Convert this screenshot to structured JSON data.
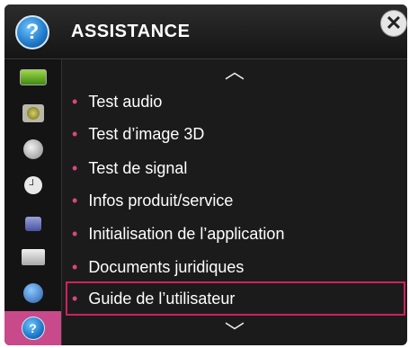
{
  "header": {
    "title": "ASSISTANCE"
  },
  "sidebar": {
    "items": [
      {
        "icon": "tv-icon"
      },
      {
        "icon": "speaker-icon"
      },
      {
        "icon": "satellite-dish-icon"
      },
      {
        "icon": "clock-icon"
      },
      {
        "icon": "lock-icon"
      },
      {
        "icon": "toolbox-icon"
      },
      {
        "icon": "globe-icon"
      },
      {
        "icon": "help-icon"
      }
    ]
  },
  "menu": {
    "items": [
      {
        "label": "Test audio"
      },
      {
        "label": "Test d’image 3D"
      },
      {
        "label": "Test de signal"
      },
      {
        "label": "Infos produit/service"
      },
      {
        "label": "Initialisation de l’application"
      },
      {
        "label": "Documents juridiques"
      },
      {
        "label": "Guide de l’utilisateur"
      }
    ]
  },
  "colors": {
    "accent": "#d0205f",
    "bullet": "#d9477e",
    "background": "#1b1b1b"
  }
}
